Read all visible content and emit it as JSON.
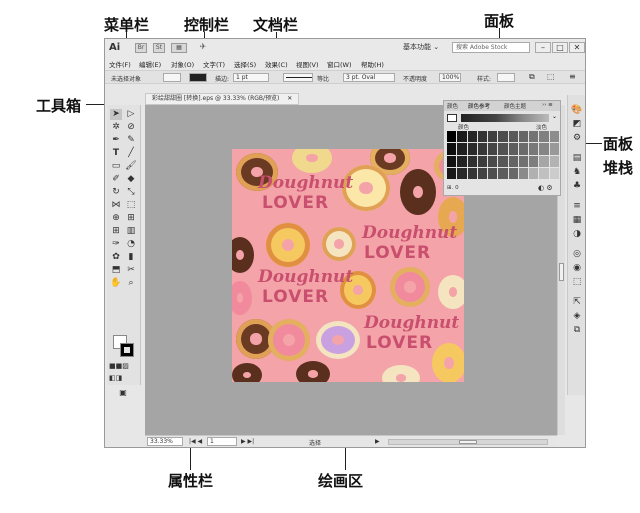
{
  "callouts": {
    "menubar": "菜单栏",
    "controlbar": "控制栏",
    "docbar": "文档栏",
    "panel": "面板",
    "toolbox": "工具箱",
    "panel_stack_1": "面板",
    "panel_stack_2": "堆栈",
    "statusbar": "属性栏",
    "canvas": "绘画区"
  },
  "titlebar": {
    "logo": "Ai",
    "bridge_icon": "Br",
    "stock_icon": "St",
    "workspace": "基本功能 ⌄",
    "search_placeholder": "搜索 Adobe Stock",
    "minimize": "–",
    "restore": "□",
    "close": "✕"
  },
  "menubar": {
    "items": [
      "文件(F)",
      "编辑(E)",
      "对象(O)",
      "文字(T)",
      "选择(S)",
      "效果(C)",
      "视图(V)",
      "窗口(W)",
      "帮助(H)"
    ]
  },
  "controlbar": {
    "selection": "未选择对象",
    "stroke_label": "描边:",
    "stroke_value": "1 pt",
    "line_style": "等比",
    "brush": "3 pt. Oval",
    "opacity_label": "不透明度",
    "opacity_value": "100%",
    "style_label": "样式:"
  },
  "document": {
    "tab_label": "彩绘甜甜圈 [转换].eps @ 33.33% (RGB/预览)",
    "tab_close": "✕"
  },
  "color_panel": {
    "tabs": [
      "颜色",
      "颜色参考",
      "颜色主题"
    ],
    "row_left": "颜色",
    "row_right": "淡色",
    "footer_left": "⊞. 0",
    "swatch_colors": [
      "#000000",
      "#1a1a1a",
      "#262626",
      "#333333",
      "#404040",
      "#4d4d4d",
      "#595959",
      "#666666",
      "#737373",
      "#808080",
      "#8c8c8c",
      "#0d0d0d",
      "#1f1f1f",
      "#2b2b2b",
      "#383838",
      "#454545",
      "#525252",
      "#5e5e5e",
      "#6b6b6b",
      "#787878",
      "#858585",
      "#999999",
      "#111111",
      "#222222",
      "#303030",
      "#3d3d3d",
      "#4a4a4a",
      "#575757",
      "#646464",
      "#717171",
      "#7e7e7e",
      "#a6a6a6",
      "#b3b3b3",
      "#181818",
      "#282828",
      "#353535",
      "#424242",
      "#4f4f4f",
      "#5c5c5c",
      "#696969",
      "#8a8a8a",
      "#b0b0b0",
      "#c0c0c0",
      "#cccccc"
    ]
  },
  "artwork": {
    "word1": "Doughnut",
    "word2": "LOVER"
  },
  "statusbar": {
    "zoom": "33.33%",
    "page": "1",
    "mode": "选择"
  }
}
